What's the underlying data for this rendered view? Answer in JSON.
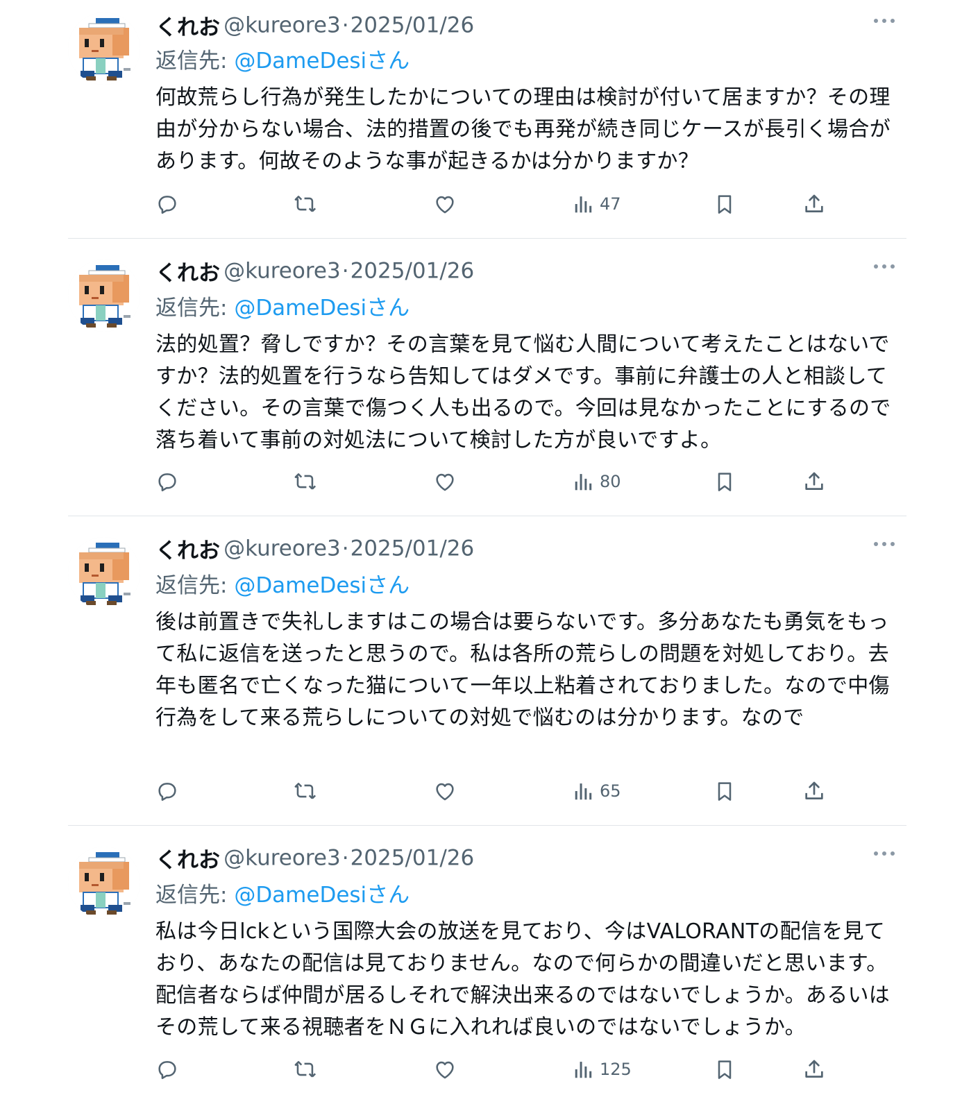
{
  "tweets": [
    {
      "author_name": "くれお",
      "handle": "@kureore3",
      "separator": "·",
      "date": "2025/01/26",
      "reply_label": "返信先: ",
      "reply_to": "@DameDesiさん",
      "text": "何故荒らし行為が発生したかについての理由は検討が付いて居ますか？その理由が分からない場合、法的措置の後でも再発が続き同じケースが長引く場合があります。何故そのような事が起きるかは分かりますか？",
      "views": "47"
    },
    {
      "author_name": "くれお",
      "handle": "@kureore3",
      "separator": "·",
      "date": "2025/01/26",
      "reply_label": "返信先: ",
      "reply_to": "@DameDesiさん",
      "text": "法的処置？脅しですか？その言葉を見て悩む人間について考えたことはないですか？法的処置を行うなら告知してはダメです。事前に弁護士の人と相談してください。その言葉で傷つく人も出るので。今回は見なかったことにするので落ち着いて事前の対処法について検討した方が良いですよ。",
      "views": "80"
    },
    {
      "author_name": "くれお",
      "handle": "@kureore3",
      "separator": "·",
      "date": "2025/01/26",
      "reply_label": "返信先: ",
      "reply_to": "@DameDesiさん",
      "text": "後は前置きで失礼しますはこの場合は要らないです。多分あなたも勇気をもって私に返信を送ったと思うので。私は各所の荒らしの問題を対処しており。去年も匿名で亡くなった猫について一年以上粘着されておりました。なので中傷行為をして来る荒らしについての対処で悩むのは分かります。なので",
      "views": "65"
    },
    {
      "author_name": "くれお",
      "handle": "@kureore3",
      "separator": "·",
      "date": "2025/01/26",
      "reply_label": "返信先: ",
      "reply_to": "@DameDesiさん",
      "text": "私は今日lckという国際大会の放送を見ており、今はVALORANTの配信を見ており、あなたの配信は見ておりません。なので何らかの間違いだと思います。配信者ならば仲間が居るしそれで解決出来るのではないでしょうか。あるいはその荒して来る視聴者をＮＧに入れれば良いのではないでしょうか。",
      "views": "125"
    }
  ],
  "icons": {
    "reply": "reply-icon",
    "retweet": "retweet-icon",
    "like": "like-icon",
    "views": "views-icon",
    "bookmark": "bookmark-icon",
    "share": "share-icon",
    "more": "more-icon"
  },
  "colors": {
    "text": "#0f1419",
    "secondary": "#536471",
    "mention": "#1d9bf0",
    "divider": "#e1e5e9"
  }
}
